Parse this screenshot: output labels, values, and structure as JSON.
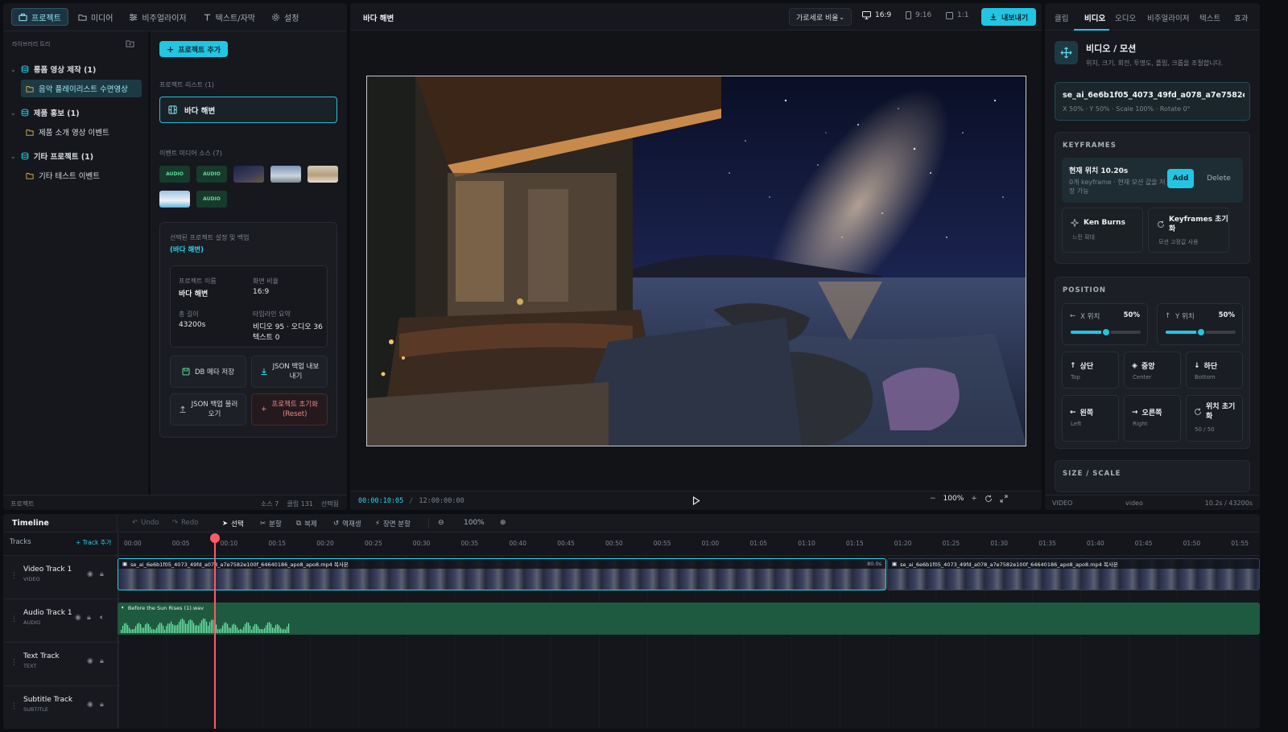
{
  "left_nav": {
    "tabs": [
      {
        "label": "프로젝트",
        "active": true
      },
      {
        "label": "미디어"
      },
      {
        "label": "비주얼라이저"
      },
      {
        "label": "텍스트/자막"
      },
      {
        "label": "설정"
      }
    ]
  },
  "library": {
    "label": "라이브러리 트리",
    "groups": [
      {
        "label": "롱폼 영상 제작 (1)",
        "items": [
          "음악 플레이리스트 수면영상"
        ]
      },
      {
        "label": "제품 홍보 (1)",
        "items": [
          "제품 소개 영상 이벤트"
        ]
      },
      {
        "label": "기타 프로젝트 (1)",
        "items": [
          "기타 테스트 이벤트"
        ]
      }
    ],
    "footer_left": "프로젝트",
    "footer_right": [
      "소스 7",
      "클립 131",
      "선택됨"
    ]
  },
  "projects": {
    "add_button": "프로젝트 추가",
    "list_label": "프로젝트 리스트 (1)",
    "items": [
      "바다 해변"
    ],
    "media_label": "이벤트 미디어 소스 (7)",
    "audio_tag": "AUDIO",
    "settings": {
      "title": "선택된 프로젝트 설정 및 백업",
      "subtitle": "(바다 해변)",
      "name_label": "프로젝트 이름",
      "name_value": "바다 해변",
      "ratio_label": "화면 비율",
      "ratio_value": "16:9",
      "length_label": "총 길이",
      "length_value": "43200s",
      "summary_label": "타임라인 요약",
      "summary_value_1": "비디오 95 · 오디오 36 ·",
      "summary_value_2": "텍스트 0"
    },
    "buttons": {
      "db_save": "DB 메타 저장",
      "json_export_1": "JSON 백업 내보",
      "json_export_2": "내기",
      "json_import_1": "JSON 백업 불러",
      "json_import_2": "오기",
      "reset_1": "프로젝트 초기화",
      "reset_2": "(Reset)"
    }
  },
  "preview": {
    "title": "바다 해변",
    "ratio_select": "가로세로 비율",
    "ratios": [
      "16:9",
      "9:16",
      "1:1"
    ],
    "export": "내보내기",
    "time_current": "00:00:10:05",
    "time_sep": "/",
    "time_total": "12:00:00:00",
    "zoom": "100%"
  },
  "inspector": {
    "tabs": [
      "클립",
      "비디오",
      "오디오",
      "비주얼라이저",
      "텍스트",
      "효과"
    ],
    "active_tab": "비디오",
    "header_title": "비디오 / 모션",
    "header_desc": "위치, 크기, 회전, 투명도, 플립, 크롭을 조절합니다.",
    "clip_name": "se_ai_6e6b1f05_4073_49fd_a078_a7e7582e10…",
    "clip_meta": "X 50% · Y 50% · Scale 100% · Rotate 0°",
    "keyframes": {
      "title": "KEYFRAMES",
      "position_line": "현재 위치 10.20s",
      "desc_1": "0개 keyframe · 현재 모션 값을 저",
      "desc_2": "장 가능",
      "add": "Add",
      "delete": "Delete",
      "ken_burns": "Ken Burns",
      "ken_burns_sub": "느린 확대",
      "reset_1": "Keyframes 초기",
      "reset_2": "화",
      "reset_sub": "모션 고정값 사용"
    },
    "position": {
      "title": "POSITION",
      "x_label": "X 위치",
      "x_value": "50%",
      "y_label": "Y 위치",
      "y_value": "50%",
      "x_level": 0.5,
      "y_level": 0.5,
      "buttons": [
        {
          "label": "상단",
          "sub": "Top"
        },
        {
          "label": "중앙",
          "sub": "Center"
        },
        {
          "label": "하단",
          "sub": "Bottom"
        },
        {
          "label": "왼쪽",
          "sub": "Left"
        },
        {
          "label": "오른쪽",
          "sub": "Right"
        },
        {
          "label": "위치 초기",
          "label2": "화",
          "sub": "50 / 50"
        }
      ]
    },
    "size_title": "SIZE / SCALE",
    "footer_left": "VIDEO",
    "footer_mid": "video",
    "footer_right": "10.2s / 43200s"
  },
  "timeline": {
    "title": "Timeline",
    "undo": "Undo",
    "redo": "Redo",
    "select": "선택",
    "split": "분할",
    "copy": "복제",
    "ripple": "역재생",
    "scene_split": "장면 분할",
    "zoom": "100%",
    "tracks_label": "Tracks",
    "add_track": "+ Track 추가",
    "ticks": [
      "00:00",
      "00:05",
      "00:10",
      "00:15",
      "00:20",
      "00:25",
      "00:30",
      "00:35",
      "00:40",
      "00:45",
      "00:50",
      "00:55",
      "01:00",
      "01:05",
      "01:10",
      "01:15",
      "01:20",
      "01:25",
      "01:30",
      "01:35",
      "01:40",
      "01:45",
      "01:50",
      "01:55"
    ],
    "tracks": [
      {
        "name": "Video Track 1",
        "type": "VIDEO"
      },
      {
        "name": "Audio Track 1",
        "type": "AUDIO"
      },
      {
        "name": "Text Track",
        "type": "TEXT"
      },
      {
        "name": "Subtitle Track",
        "type": "SUBTITLE"
      }
    ],
    "clip1_name": "se_ai_6e6b1f05_4073_49fd_a078_a7e7582e100f_64640186_apo8_apo8.mp4 복사본",
    "clip1_duration": "80.0s",
    "clip2_name": "se_ai_6e6b1f05_4073_49fd_a078_a7e7582e100f_64640186_apo8_apo8.mp4 복사본",
    "audio_clip_name": "Before the Sun Rises (1).wav"
  }
}
